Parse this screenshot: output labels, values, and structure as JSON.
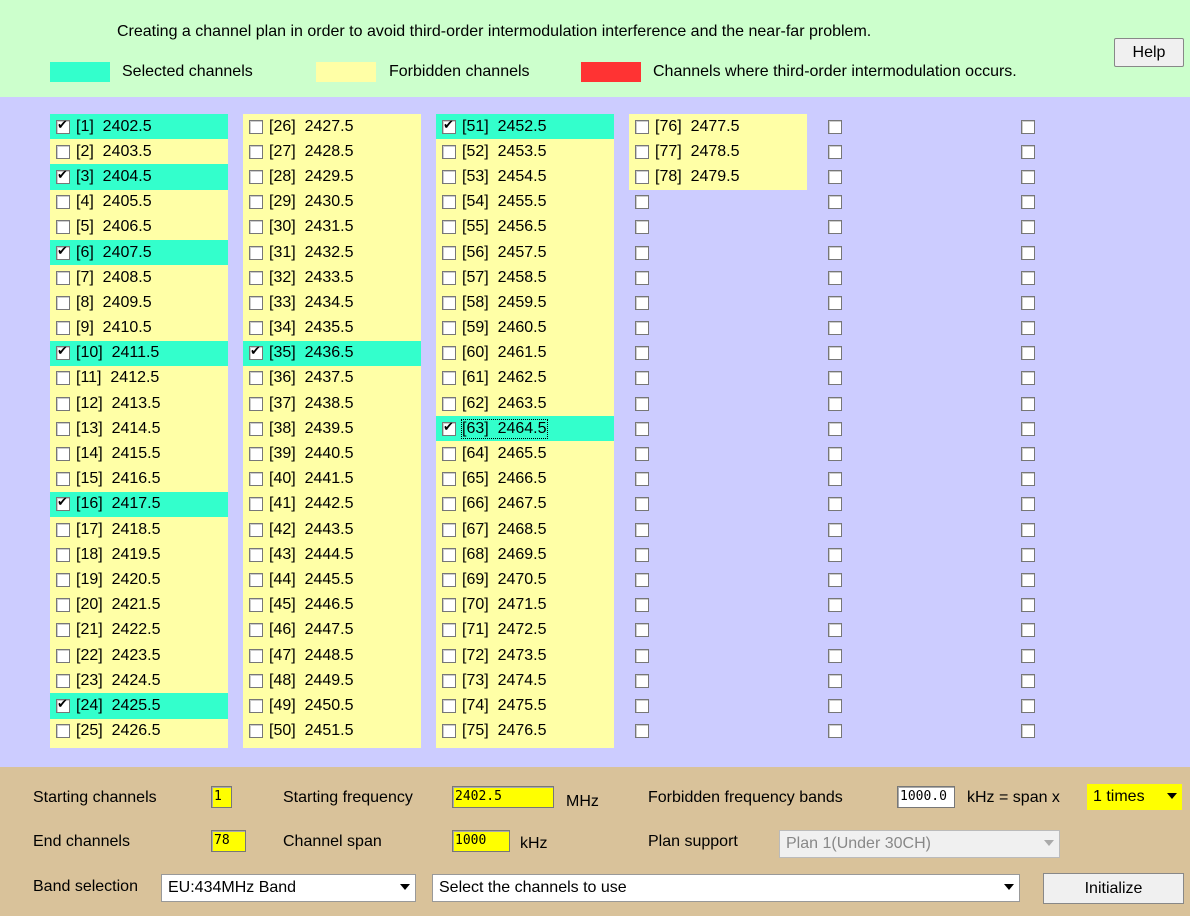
{
  "header": {
    "title": "Creating a channel plan in order to avoid third-order intermodulation interference and the near-far problem.",
    "help_label": "Help",
    "legend": [
      {
        "label": "Selected channels",
        "color": "#33ffcc"
      },
      {
        "label": "Forbidden channels",
        "color": "#ffffa6"
      },
      {
        "label": "Channels where third-order intermodulation occurs.",
        "color": "#ff3333"
      }
    ]
  },
  "channels": {
    "columns": [
      [
        {
          "label": "[1]  2402.5",
          "checked": true,
          "state": "selected"
        },
        {
          "label": "[2]  2403.5",
          "checked": false,
          "state": "forbidden"
        },
        {
          "label": "[3]  2404.5",
          "checked": true,
          "state": "selected"
        },
        {
          "label": "[4]  2405.5",
          "checked": false,
          "state": "forbidden"
        },
        {
          "label": "[5]  2406.5",
          "checked": false,
          "state": "forbidden"
        },
        {
          "label": "[6]  2407.5",
          "checked": true,
          "state": "selected"
        },
        {
          "label": "[7]  2408.5",
          "checked": false,
          "state": "forbidden"
        },
        {
          "label": "[8]  2409.5",
          "checked": false,
          "state": "forbidden"
        },
        {
          "label": "[9]  2410.5",
          "checked": false,
          "state": "forbidden"
        },
        {
          "label": "[10]  2411.5",
          "checked": true,
          "state": "selected"
        },
        {
          "label": "[11]  2412.5",
          "checked": false,
          "state": "forbidden"
        },
        {
          "label": "[12]  2413.5",
          "checked": false,
          "state": "forbidden"
        },
        {
          "label": "[13]  2414.5",
          "checked": false,
          "state": "forbidden"
        },
        {
          "label": "[14]  2415.5",
          "checked": false,
          "state": "forbidden"
        },
        {
          "label": "[15]  2416.5",
          "checked": false,
          "state": "forbidden"
        },
        {
          "label": "[16]  2417.5",
          "checked": true,
          "state": "selected"
        },
        {
          "label": "[17]  2418.5",
          "checked": false,
          "state": "forbidden"
        },
        {
          "label": "[18]  2419.5",
          "checked": false,
          "state": "forbidden"
        },
        {
          "label": "[19]  2420.5",
          "checked": false,
          "state": "forbidden"
        },
        {
          "label": "[20]  2421.5",
          "checked": false,
          "state": "forbidden"
        },
        {
          "label": "[21]  2422.5",
          "checked": false,
          "state": "forbidden"
        },
        {
          "label": "[22]  2423.5",
          "checked": false,
          "state": "forbidden"
        },
        {
          "label": "[23]  2424.5",
          "checked": false,
          "state": "forbidden"
        },
        {
          "label": "[24]  2425.5",
          "checked": true,
          "state": "selected"
        },
        {
          "label": "[25]  2426.5",
          "checked": false,
          "state": "forbidden"
        }
      ],
      [
        {
          "label": "[26]  2427.5",
          "checked": false,
          "state": "forbidden"
        },
        {
          "label": "[27]  2428.5",
          "checked": false,
          "state": "forbidden"
        },
        {
          "label": "[28]  2429.5",
          "checked": false,
          "state": "forbidden"
        },
        {
          "label": "[29]  2430.5",
          "checked": false,
          "state": "forbidden"
        },
        {
          "label": "[30]  2431.5",
          "checked": false,
          "state": "forbidden"
        },
        {
          "label": "[31]  2432.5",
          "checked": false,
          "state": "forbidden"
        },
        {
          "label": "[32]  2433.5",
          "checked": false,
          "state": "forbidden"
        },
        {
          "label": "[33]  2434.5",
          "checked": false,
          "state": "forbidden"
        },
        {
          "label": "[34]  2435.5",
          "checked": false,
          "state": "forbidden"
        },
        {
          "label": "[35]  2436.5",
          "checked": true,
          "state": "selected"
        },
        {
          "label": "[36]  2437.5",
          "checked": false,
          "state": "forbidden"
        },
        {
          "label": "[37]  2438.5",
          "checked": false,
          "state": "forbidden"
        },
        {
          "label": "[38]  2439.5",
          "checked": false,
          "state": "forbidden"
        },
        {
          "label": "[39]  2440.5",
          "checked": false,
          "state": "forbidden"
        },
        {
          "label": "[40]  2441.5",
          "checked": false,
          "state": "forbidden"
        },
        {
          "label": "[41]  2442.5",
          "checked": false,
          "state": "forbidden"
        },
        {
          "label": "[42]  2443.5",
          "checked": false,
          "state": "forbidden"
        },
        {
          "label": "[43]  2444.5",
          "checked": false,
          "state": "forbidden"
        },
        {
          "label": "[44]  2445.5",
          "checked": false,
          "state": "forbidden"
        },
        {
          "label": "[45]  2446.5",
          "checked": false,
          "state": "forbidden"
        },
        {
          "label": "[46]  2447.5",
          "checked": false,
          "state": "forbidden"
        },
        {
          "label": "[47]  2448.5",
          "checked": false,
          "state": "forbidden"
        },
        {
          "label": "[48]  2449.5",
          "checked": false,
          "state": "forbidden"
        },
        {
          "label": "[49]  2450.5",
          "checked": false,
          "state": "forbidden"
        },
        {
          "label": "[50]  2451.5",
          "checked": false,
          "state": "forbidden"
        }
      ],
      [
        {
          "label": "[51]  2452.5",
          "checked": true,
          "state": "selected"
        },
        {
          "label": "[52]  2453.5",
          "checked": false,
          "state": "forbidden"
        },
        {
          "label": "[53]  2454.5",
          "checked": false,
          "state": "forbidden"
        },
        {
          "label": "[54]  2455.5",
          "checked": false,
          "state": "forbidden"
        },
        {
          "label": "[55]  2456.5",
          "checked": false,
          "state": "forbidden"
        },
        {
          "label": "[56]  2457.5",
          "checked": false,
          "state": "forbidden"
        },
        {
          "label": "[57]  2458.5",
          "checked": false,
          "state": "forbidden"
        },
        {
          "label": "[58]  2459.5",
          "checked": false,
          "state": "forbidden"
        },
        {
          "label": "[59]  2460.5",
          "checked": false,
          "state": "forbidden"
        },
        {
          "label": "[60]  2461.5",
          "checked": false,
          "state": "forbidden"
        },
        {
          "label": "[61]  2462.5",
          "checked": false,
          "state": "forbidden"
        },
        {
          "label": "[62]  2463.5",
          "checked": false,
          "state": "forbidden"
        },
        {
          "label": "[63]  2464.5",
          "checked": true,
          "state": "selected",
          "focused": true
        },
        {
          "label": "[64]  2465.5",
          "checked": false,
          "state": "forbidden"
        },
        {
          "label": "[65]  2466.5",
          "checked": false,
          "state": "forbidden"
        },
        {
          "label": "[66]  2467.5",
          "checked": false,
          "state": "forbidden"
        },
        {
          "label": "[67]  2468.5",
          "checked": false,
          "state": "forbidden"
        },
        {
          "label": "[68]  2469.5",
          "checked": false,
          "state": "forbidden"
        },
        {
          "label": "[69]  2470.5",
          "checked": false,
          "state": "forbidden"
        },
        {
          "label": "[70]  2471.5",
          "checked": false,
          "state": "forbidden"
        },
        {
          "label": "[71]  2472.5",
          "checked": false,
          "state": "forbidden"
        },
        {
          "label": "[72]  2473.5",
          "checked": false,
          "state": "forbidden"
        },
        {
          "label": "[73]  2474.5",
          "checked": false,
          "state": "forbidden"
        },
        {
          "label": "[74]  2475.5",
          "checked": false,
          "state": "forbidden"
        },
        {
          "label": "[75]  2476.5",
          "checked": false,
          "state": "forbidden"
        }
      ],
      [
        {
          "label": "[76]  2477.5",
          "checked": false,
          "state": "forbidden"
        },
        {
          "label": "[77]  2478.5",
          "checked": false,
          "state": "forbidden"
        },
        {
          "label": "[78]  2479.5",
          "checked": false,
          "state": "forbidden"
        },
        {
          "label": "",
          "checked": false,
          "state": "none"
        },
        {
          "label": "",
          "checked": false,
          "state": "none"
        },
        {
          "label": "",
          "checked": false,
          "state": "none"
        },
        {
          "label": "",
          "checked": false,
          "state": "none"
        },
        {
          "label": "",
          "checked": false,
          "state": "none"
        },
        {
          "label": "",
          "checked": false,
          "state": "none"
        },
        {
          "label": "",
          "checked": false,
          "state": "none"
        },
        {
          "label": "",
          "checked": false,
          "state": "none"
        },
        {
          "label": "",
          "checked": false,
          "state": "none"
        },
        {
          "label": "",
          "checked": false,
          "state": "none"
        },
        {
          "label": "",
          "checked": false,
          "state": "none"
        },
        {
          "label": "",
          "checked": false,
          "state": "none"
        },
        {
          "label": "",
          "checked": false,
          "state": "none"
        },
        {
          "label": "",
          "checked": false,
          "state": "none"
        },
        {
          "label": "",
          "checked": false,
          "state": "none"
        },
        {
          "label": "",
          "checked": false,
          "state": "none"
        },
        {
          "label": "",
          "checked": false,
          "state": "none"
        },
        {
          "label": "",
          "checked": false,
          "state": "none"
        },
        {
          "label": "",
          "checked": false,
          "state": "none"
        },
        {
          "label": "",
          "checked": false,
          "state": "none"
        },
        {
          "label": "",
          "checked": false,
          "state": "none"
        },
        {
          "label": "",
          "checked": false,
          "state": "none"
        }
      ],
      [
        {
          "label": "",
          "checked": false,
          "state": "none"
        },
        {
          "label": "",
          "checked": false,
          "state": "none"
        },
        {
          "label": "",
          "checked": false,
          "state": "none"
        },
        {
          "label": "",
          "checked": false,
          "state": "none"
        },
        {
          "label": "",
          "checked": false,
          "state": "none"
        },
        {
          "label": "",
          "checked": false,
          "state": "none"
        },
        {
          "label": "",
          "checked": false,
          "state": "none"
        },
        {
          "label": "",
          "checked": false,
          "state": "none"
        },
        {
          "label": "",
          "checked": false,
          "state": "none"
        },
        {
          "label": "",
          "checked": false,
          "state": "none"
        },
        {
          "label": "",
          "checked": false,
          "state": "none"
        },
        {
          "label": "",
          "checked": false,
          "state": "none"
        },
        {
          "label": "",
          "checked": false,
          "state": "none"
        },
        {
          "label": "",
          "checked": false,
          "state": "none"
        },
        {
          "label": "",
          "checked": false,
          "state": "none"
        },
        {
          "label": "",
          "checked": false,
          "state": "none"
        },
        {
          "label": "",
          "checked": false,
          "state": "none"
        },
        {
          "label": "",
          "checked": false,
          "state": "none"
        },
        {
          "label": "",
          "checked": false,
          "state": "none"
        },
        {
          "label": "",
          "checked": false,
          "state": "none"
        },
        {
          "label": "",
          "checked": false,
          "state": "none"
        },
        {
          "label": "",
          "checked": false,
          "state": "none"
        },
        {
          "label": "",
          "checked": false,
          "state": "none"
        },
        {
          "label": "",
          "checked": false,
          "state": "none"
        },
        {
          "label": "",
          "checked": false,
          "state": "none"
        }
      ],
      [
        {
          "label": "",
          "checked": false,
          "state": "none"
        },
        {
          "label": "",
          "checked": false,
          "state": "none"
        },
        {
          "label": "",
          "checked": false,
          "state": "none"
        },
        {
          "label": "",
          "checked": false,
          "state": "none"
        },
        {
          "label": "",
          "checked": false,
          "state": "none"
        },
        {
          "label": "",
          "checked": false,
          "state": "none"
        },
        {
          "label": "",
          "checked": false,
          "state": "none"
        },
        {
          "label": "",
          "checked": false,
          "state": "none"
        },
        {
          "label": "",
          "checked": false,
          "state": "none"
        },
        {
          "label": "",
          "checked": false,
          "state": "none"
        },
        {
          "label": "",
          "checked": false,
          "state": "none"
        },
        {
          "label": "",
          "checked": false,
          "state": "none"
        },
        {
          "label": "",
          "checked": false,
          "state": "none"
        },
        {
          "label": "",
          "checked": false,
          "state": "none"
        },
        {
          "label": "",
          "checked": false,
          "state": "none"
        },
        {
          "label": "",
          "checked": false,
          "state": "none"
        },
        {
          "label": "",
          "checked": false,
          "state": "none"
        },
        {
          "label": "",
          "checked": false,
          "state": "none"
        },
        {
          "label": "",
          "checked": false,
          "state": "none"
        },
        {
          "label": "",
          "checked": false,
          "state": "none"
        },
        {
          "label": "",
          "checked": false,
          "state": "none"
        },
        {
          "label": "",
          "checked": false,
          "state": "none"
        },
        {
          "label": "",
          "checked": false,
          "state": "none"
        },
        {
          "label": "",
          "checked": false,
          "state": "none"
        },
        {
          "label": "",
          "checked": false,
          "state": "none"
        }
      ]
    ]
  },
  "settings": {
    "starting_channels_label": "Starting channels",
    "starting_channels_value": "1",
    "end_channels_label": "End channels",
    "end_channels_value": "78",
    "starting_frequency_label": "Starting frequency",
    "starting_frequency_value": "2402.5",
    "starting_frequency_unit": "MHz",
    "channel_span_label": "Channel span",
    "channel_span_value": "1000",
    "channel_span_unit": "kHz",
    "forbidden_bands_label": "Forbidden frequency bands",
    "forbidden_bands_value": "1000.0",
    "forbidden_bands_unit": "kHz = span x",
    "times_value": "1 times",
    "plan_support_label": "Plan support",
    "plan_support_value": "Plan 1(Under 30CH)",
    "band_selection_label": "Band selection",
    "band_selection_value": "EU:434MHz Band",
    "channels_select_value": "Select the channels to use",
    "initialize_label": "Initialize"
  }
}
